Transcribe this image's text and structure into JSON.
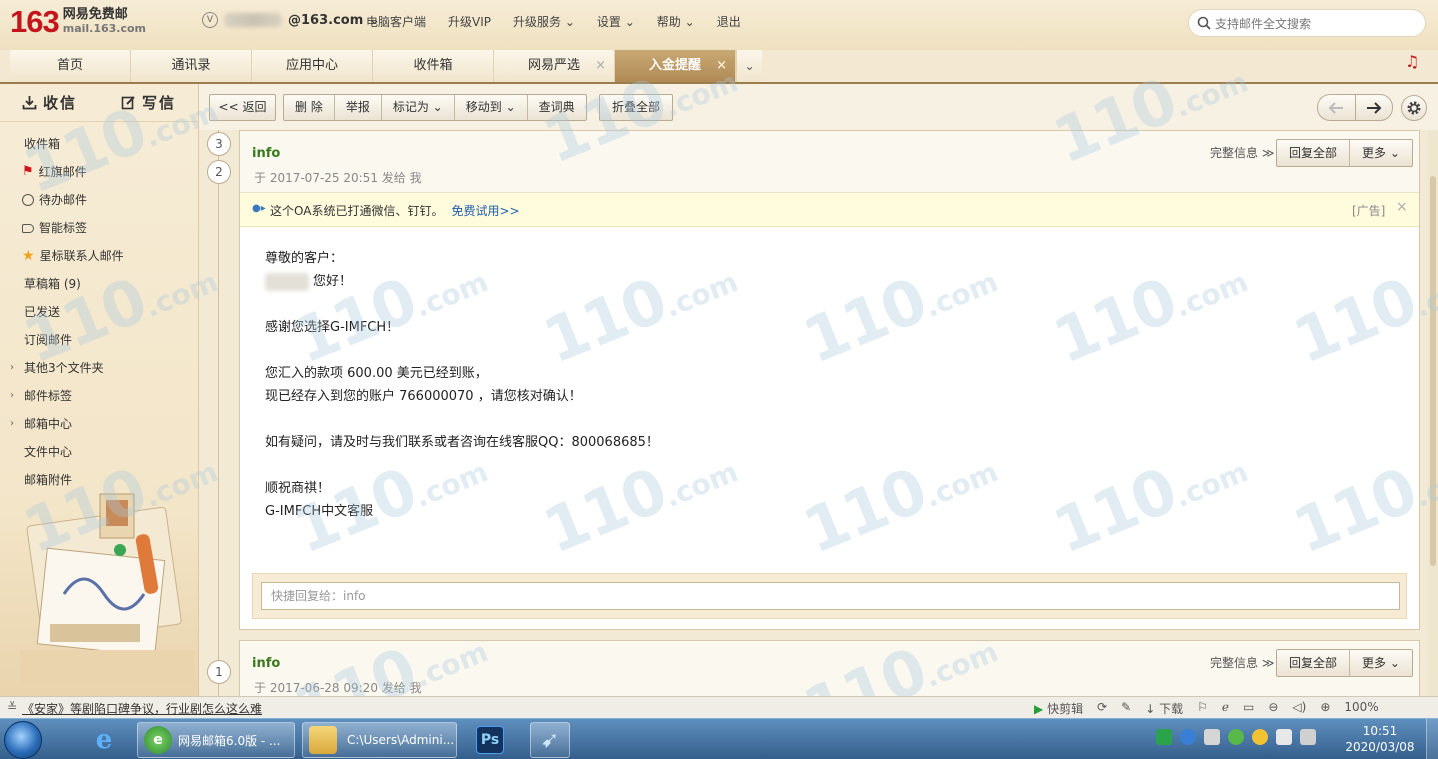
{
  "brand": {
    "number": "163",
    "title": "网易免费邮",
    "subtitle": "mail.163.com"
  },
  "account": {
    "badge": "V",
    "domain": "@163.com"
  },
  "topnav": [
    "电脑客户端",
    "升级VIP",
    "升级服务",
    "设置",
    "帮助",
    "退出"
  ],
  "search": {
    "placeholder": "支持邮件全文搜索"
  },
  "tabs": [
    {
      "label": "首页"
    },
    {
      "label": "通讯录"
    },
    {
      "label": "应用中心"
    },
    {
      "label": "收件箱"
    },
    {
      "label": "网易严选",
      "close": "×"
    },
    {
      "label": "入金提醒",
      "close": "×"
    }
  ],
  "sidebar": {
    "receive": "收信",
    "compose": "写信",
    "folders": [
      "收件箱",
      "红旗邮件",
      "待办邮件",
      "智能标签",
      "星标联系人邮件",
      "草稿箱 (9)",
      "已发送",
      "订阅邮件",
      "其他3个文件夹",
      "邮件标签",
      "邮箱中心",
      "文件中心",
      "邮箱附件"
    ]
  },
  "toolbar": {
    "back": "<< 返回",
    "delete": "删 除",
    "report": "举报",
    "mark_as": "标记为",
    "move_to": "移动到",
    "dictionary": "查词典",
    "collapse_all": "折叠全部"
  },
  "thread": {
    "bubbles": [
      "3",
      "2",
      "1"
    ],
    "messages": [
      {
        "sender": "info",
        "meta": "于 2017-07-25 20:51 发给 我",
        "full_info": "完整信息",
        "reply_all": "回复全部",
        "more": "更多",
        "ad": {
          "text": "这个OA系统已打通微信、钉钉。",
          "link": "免费试用>>",
          "tag": "[广告]",
          "close": "×"
        },
        "body": {
          "greeting": "尊敬的客户：",
          "hello": "您好！",
          "thanks": "感谢您选择G-IMFCH！",
          "line1": "您汇入的款项 600.00 美元已经到账，",
          "line2": "现已经存入到您的账户 766000070 ，请您核对确认！",
          "line3": "如有疑问，请及时与我们联系或者咨询在线客服QQ：800068685！",
          "closing": "顺祝商祺！",
          "signature": "G-IMFCH中文客服"
        },
        "quick_reply_placeholder": "快捷回复给：info"
      },
      {
        "sender": "info",
        "meta": "于 2017-06-28 09:20 发给 我",
        "full_info": "完整信息",
        "reply_all": "回复全部",
        "more": "更多"
      }
    ]
  },
  "watermark": {
    "big": "110",
    "small": ".com"
  },
  "statusbar": {
    "news": "《安家》等剧陷口碑争议，行业剧怎么这么难",
    "items": [
      "快剪辑",
      "下载"
    ],
    "zoom": "100%"
  },
  "taskbar": {
    "items": [
      {
        "label": "网易邮箱6.0版 - ..."
      },
      {
        "label": "C:\\Users\\Admini..."
      }
    ],
    "ps_label": "Ps",
    "time": "10:51",
    "date": "2020/03/08"
  },
  "colors": {
    "brand_red": "#c3161c",
    "sender_green": "#3a7a1c",
    "link_blue": "#1f5fae",
    "active_tab": "#b08a55"
  }
}
